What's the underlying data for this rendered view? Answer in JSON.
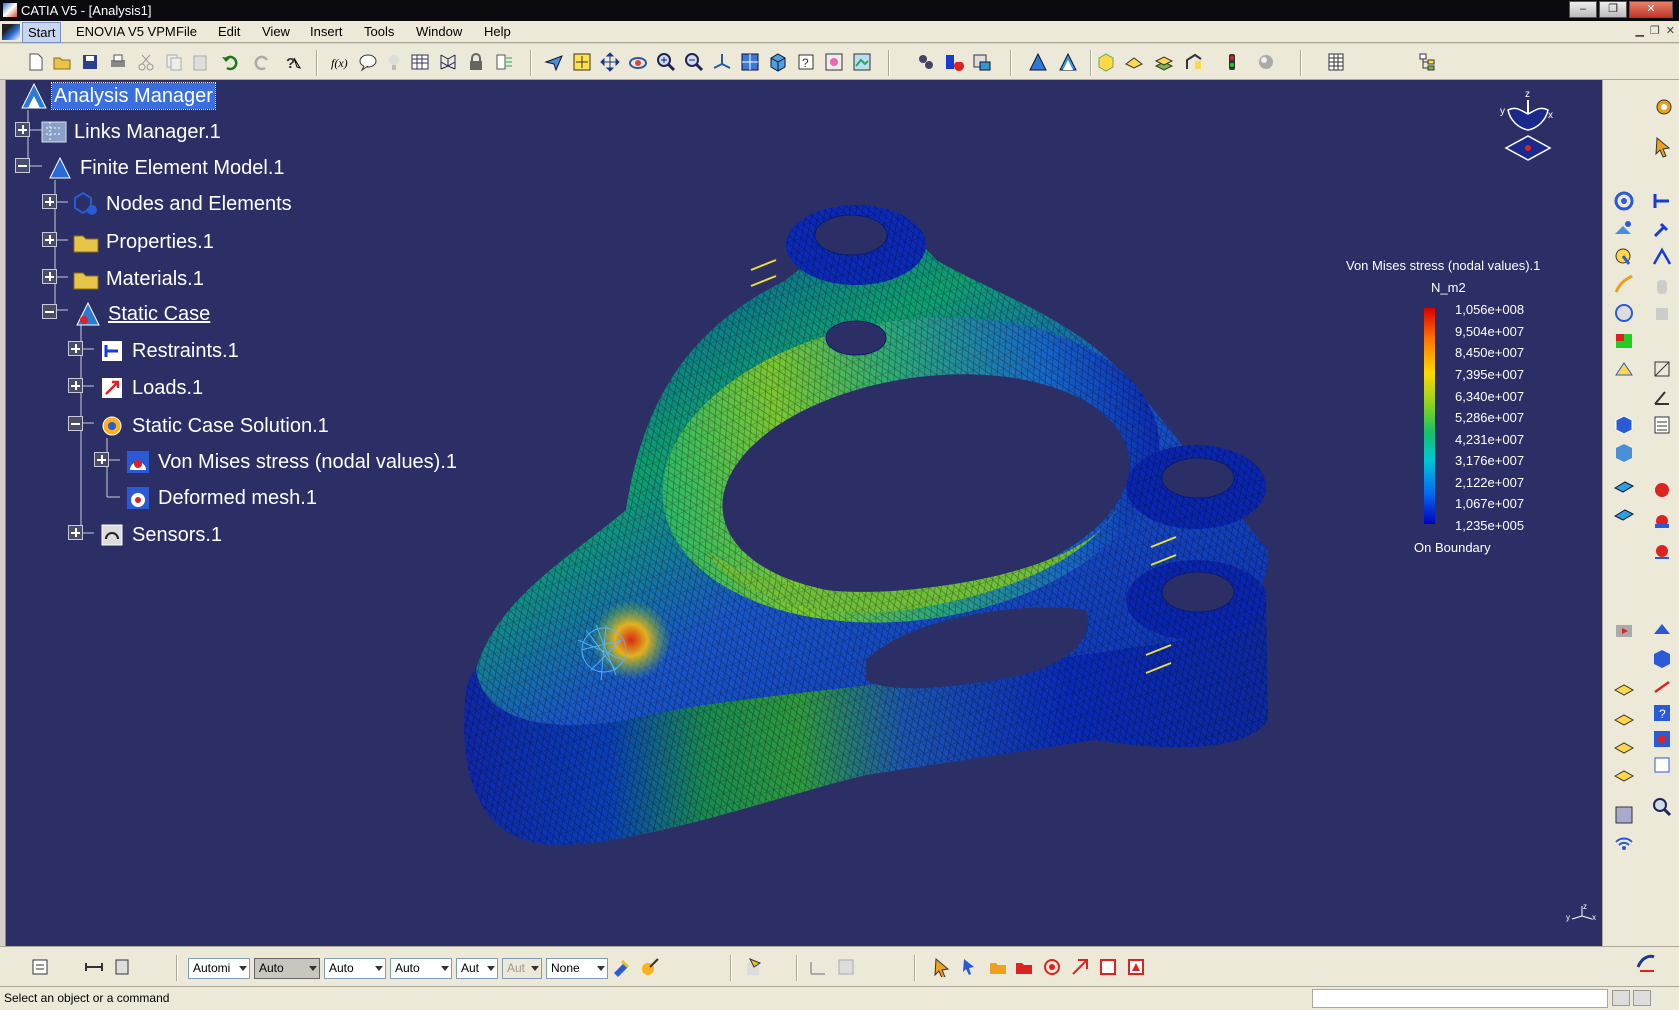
{
  "window": {
    "title": "CATIA V5 - [Analysis1]"
  },
  "menu": {
    "items": [
      {
        "label": "Start"
      },
      {
        "label": "ENOVIA V5 VPM"
      },
      {
        "label": "File"
      },
      {
        "label": "Edit"
      },
      {
        "label": "View"
      },
      {
        "label": "Insert"
      },
      {
        "label": "Tools"
      },
      {
        "label": "Window"
      },
      {
        "label": "Help"
      }
    ]
  },
  "tree": {
    "nodes": [
      {
        "label": "Analysis Manager",
        "icon": "analysis-manager-icon"
      },
      {
        "label": "Links Manager.1",
        "icon": "links-manager-icon"
      },
      {
        "label": "Finite Element Model.1",
        "icon": "fem-icon"
      },
      {
        "label": "Nodes and Elements",
        "icon": "nodes-elements-icon"
      },
      {
        "label": "Properties.1",
        "icon": "folder-icon"
      },
      {
        "label": "Materials.1",
        "icon": "folder-icon"
      },
      {
        "label": "Static Case",
        "icon": "static-case-icon"
      },
      {
        "label": "Restraints.1",
        "icon": "restraints-icon"
      },
      {
        "label": "Loads.1",
        "icon": "loads-icon"
      },
      {
        "label": "Static Case Solution.1",
        "icon": "solution-icon"
      },
      {
        "label": "Von Mises stress (nodal values).1",
        "icon": "image-icon"
      },
      {
        "label": "Deformed mesh.1",
        "icon": "deformed-mesh-icon"
      },
      {
        "label": "Sensors.1",
        "icon": "sensors-icon"
      }
    ]
  },
  "legend": {
    "title": "Von Mises stress (nodal values).1",
    "unit": "N_m2",
    "values": [
      "1,056e+008",
      "9,504e+007",
      "8,450e+007",
      "7,395e+007",
      "6,340e+007",
      "5,286e+007",
      "4,231e+007",
      "3,176e+007",
      "2,122e+007",
      "1,067e+007",
      "1,235e+005"
    ],
    "footer": "On Boundary",
    "colors": {
      "max": "#d80000",
      "high": "#ff7300",
      "mid": "#ffd800",
      "midlow": "#13c06b",
      "low": "#0070f0",
      "min": "#0000c0"
    }
  },
  "viewport": {
    "background": "#2c2f66",
    "compass_labels": {
      "z": "z",
      "y": "y",
      "x": "x"
    }
  },
  "bottom": {
    "combos": [
      {
        "value": "Automi"
      },
      {
        "value": "Auto"
      },
      {
        "value": "Auto"
      },
      {
        "value": "Auto"
      },
      {
        "value": "Aut"
      },
      {
        "value": "Aut"
      },
      {
        "value": "None"
      }
    ]
  },
  "status": {
    "text": "Select an object or a command"
  }
}
